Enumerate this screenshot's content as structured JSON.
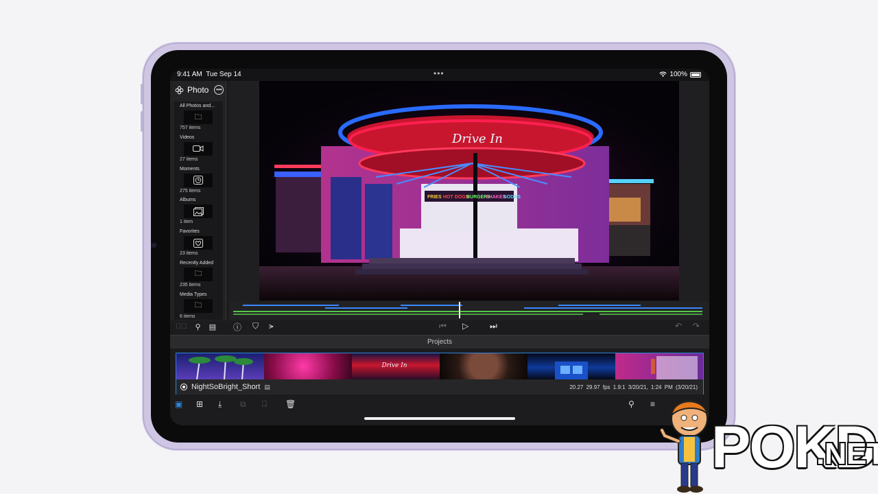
{
  "status_bar": {
    "time": "9:41 AM",
    "date": "Tue Sep 14",
    "dots": "•••",
    "battery": "100%"
  },
  "sidebar": {
    "title": "Photo",
    "items": [
      {
        "label": "All Photos and...",
        "count": "757 items",
        "icon": "folder-icon"
      },
      {
        "label": "Videos",
        "count": "27 items",
        "icon": "video-camera-icon"
      },
      {
        "label": "Moments",
        "count": "275 items",
        "icon": "clock-icon"
      },
      {
        "label": "Albums",
        "count": "1 item",
        "icon": "album-icon"
      },
      {
        "label": "Favorites",
        "count": "23 items",
        "icon": "heart-icon"
      },
      {
        "label": "Recently Added",
        "count": "235 items",
        "icon": "folder-icon"
      },
      {
        "label": "Media Types",
        "count": "6 items",
        "icon": "folder-icon"
      }
    ]
  },
  "photo": {
    "sign_text": "Drive In",
    "booth_signs": [
      "FRIES",
      "HOT DOGS",
      "BURGERS",
      "SHAKES",
      "SODAS"
    ]
  },
  "projects": {
    "section_title": "Projects",
    "project": {
      "name": "NightSoBright_Short",
      "duration": "20.27",
      "fps": "29.97 fps",
      "aspect": "1.9:1",
      "modified": "3/20/21, 1:24 PM",
      "created": "(3/20/21)"
    }
  },
  "watermark": {
    "brand": "POKDE",
    "suffix": ".NET"
  },
  "colors": {
    "accent": "#2e86de",
    "device": "#cfc6e3",
    "neon_red": "#ff2050",
    "neon_blue": "#2a6bff"
  }
}
